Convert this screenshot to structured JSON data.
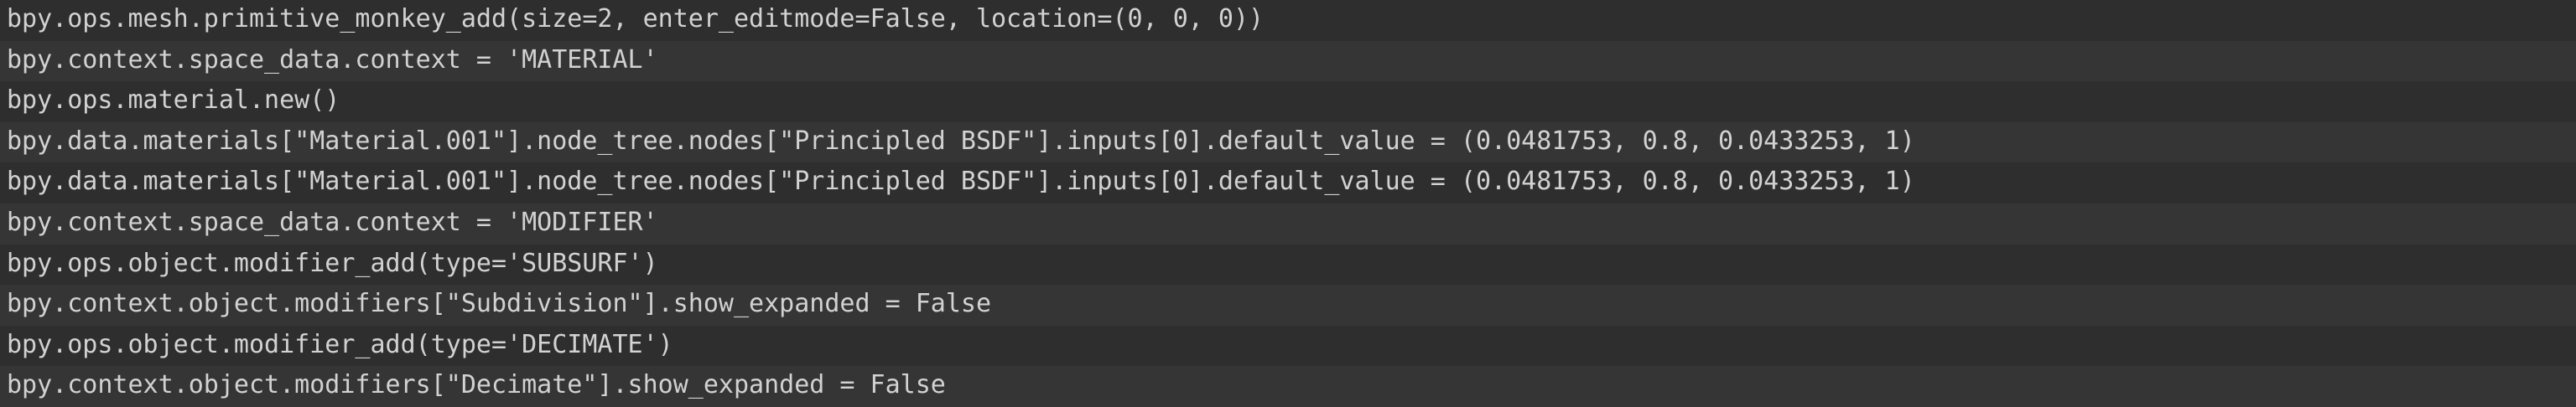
{
  "info_log": {
    "lines": [
      "bpy.ops.mesh.primitive_monkey_add(size=2, enter_editmode=False, location=(0, 0, 0))",
      "bpy.context.space_data.context = 'MATERIAL'",
      "bpy.ops.material.new()",
      "bpy.data.materials[\"Material.001\"].node_tree.nodes[\"Principled BSDF\"].inputs[0].default_value = (0.0481753, 0.8, 0.0433253, 1)",
      "bpy.data.materials[\"Material.001\"].node_tree.nodes[\"Principled BSDF\"].inputs[0].default_value = (0.0481753, 0.8, 0.0433253, 1)",
      "bpy.context.space_data.context = 'MODIFIER'",
      "bpy.ops.object.modifier_add(type='SUBSURF')",
      "bpy.context.object.modifiers[\"Subdivision\"].show_expanded = False",
      "bpy.ops.object.modifier_add(type='DECIMATE')",
      "bpy.context.object.modifiers[\"Decimate\"].show_expanded = False"
    ]
  },
  "colors": {
    "text": "#d2d2d2",
    "row_dark": "#2e2e2e",
    "row_light": "#353535"
  }
}
